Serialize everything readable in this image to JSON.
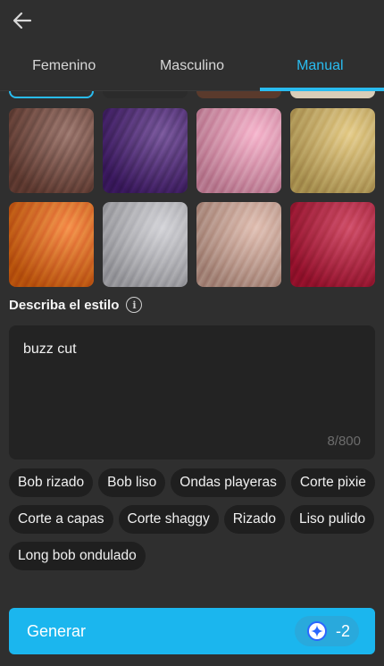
{
  "header": {
    "back_icon": "arrow-left-icon"
  },
  "tabs": [
    {
      "label": "Femenino",
      "active": false
    },
    {
      "label": "Masculino",
      "active": false
    },
    {
      "label": "Manual",
      "active": true
    }
  ],
  "accent_color": "#29bcf0",
  "swatches": [
    {
      "name": "light-brown",
      "color": "#7a4a3e"
    },
    {
      "name": "purple",
      "color": "#4a1f78"
    },
    {
      "name": "pink",
      "color": "#f3a0be"
    },
    {
      "name": "golden-blonde",
      "color": "#ddbd68"
    },
    {
      "name": "orange",
      "color": "#f26b10"
    },
    {
      "name": "silver",
      "color": "#c6c6cc"
    },
    {
      "name": "rose-beige",
      "color": "#d8ad9d"
    },
    {
      "name": "crimson",
      "color": "#c01538"
    }
  ],
  "style_section": {
    "label": "Describa el estilo",
    "info_icon": "info-icon",
    "input_value": "buzz cut",
    "counter": "8/800"
  },
  "suggestions": [
    "Bob rizado",
    "Bob liso",
    "Ondas playeras",
    "Corte pixie",
    "Corte a capas",
    "Corte shaggy",
    "Rizado",
    "Liso pulido",
    "Long bob ondulado"
  ],
  "generate": {
    "label": "Generar",
    "credit_icon": "sparkle-credit-icon",
    "credit_value": "-2"
  }
}
